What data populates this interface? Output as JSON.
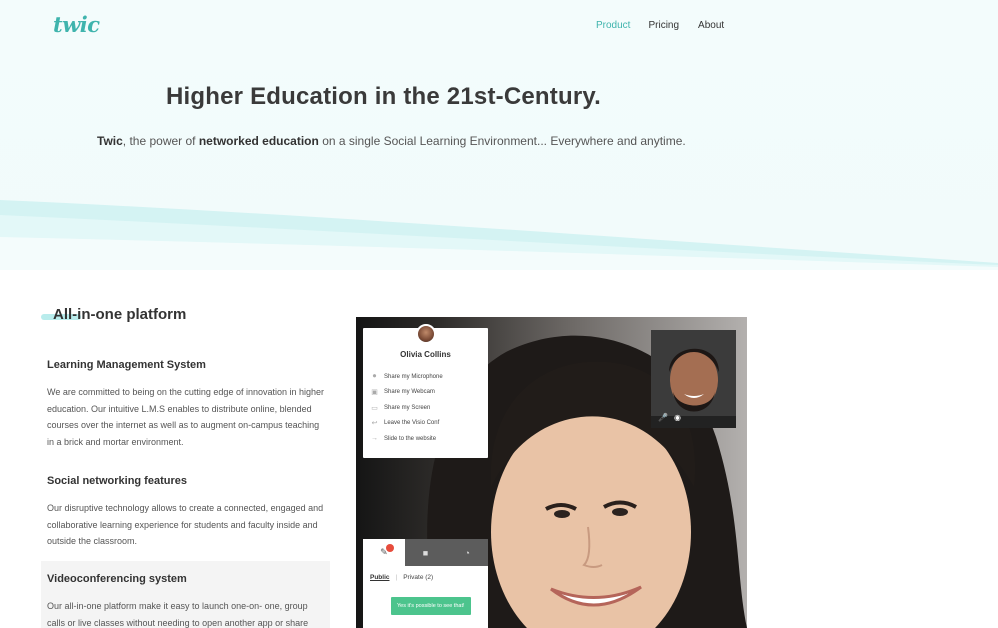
{
  "brand": {
    "logo": "twic",
    "accent": "#3fb4ad"
  },
  "nav": {
    "product": "Product",
    "pricing": "Pricing",
    "about": "About"
  },
  "hero": {
    "title": "Higher Education in the 21st-Century.",
    "subtitle_1": "Twic",
    "subtitle_2": ", the power of ",
    "subtitle_3": "networked education",
    "subtitle_4": " on a single Social Learning Environment... Everywhere and anytime."
  },
  "platform": {
    "title": "All-in-one platform",
    "features": [
      {
        "title": "Learning Management System",
        "text": "We are committed to being on the cutting edge of innovation in higher education. Our intuitive L.M.S enables to distribute online, blended courses over the internet as well as to augment on-campus teaching in a brick and mortar environment."
      },
      {
        "title": "Social networking features",
        "text": "Our disruptive technology allows to create a connected, engaged and collaborative learning experience for students and faculty inside and outside the classroom."
      },
      {
        "title": "Videoconferencing system",
        "text": "Our all-in-one platform make it easy to launch one-on- one, group calls or live classes without needing to open another app or share"
      }
    ]
  },
  "demo": {
    "panel": {
      "name": "Olivia Collins",
      "items": [
        {
          "icon": "microphone-icon",
          "label": "Share my Microphone"
        },
        {
          "icon": "webcam-icon",
          "label": "Share my Webcam"
        },
        {
          "icon": "screen-icon",
          "label": "Share my Screen"
        },
        {
          "icon": "leave-icon",
          "label": "Leave the Visio Conf"
        },
        {
          "icon": "arrow-icon",
          "label": "Slide to the website"
        }
      ]
    },
    "chat": {
      "public": "Public",
      "private": "Private (2)",
      "message": "Yes it's possible to see that!"
    }
  }
}
